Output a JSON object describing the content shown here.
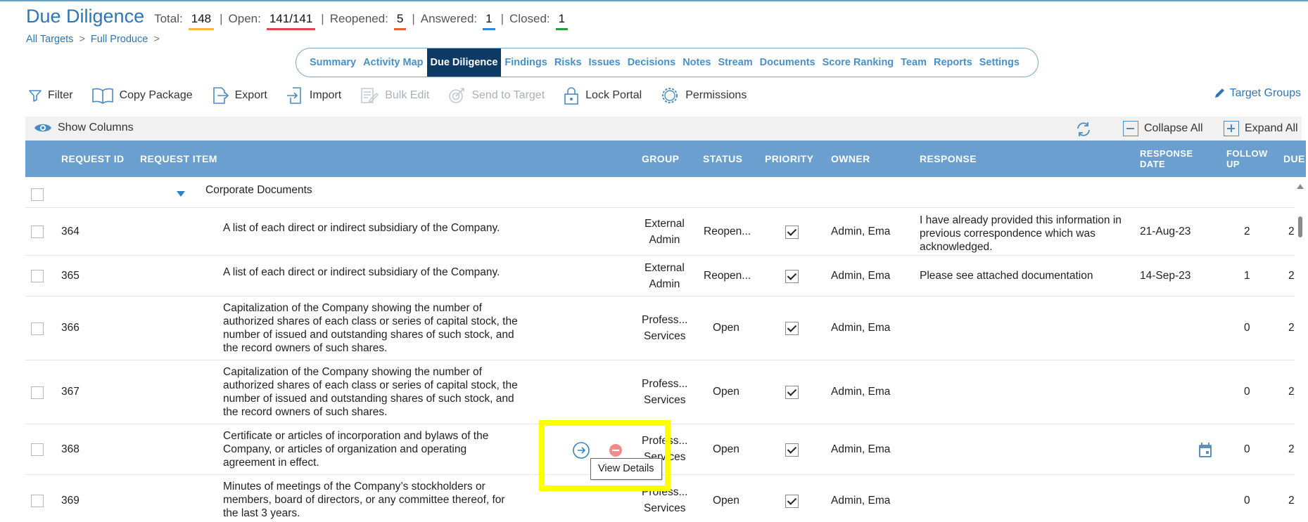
{
  "header": {
    "title": "Due Diligence",
    "stats": [
      {
        "label": "Total:",
        "value": "148",
        "color": "#f4b942"
      },
      {
        "label": "Open:",
        "value": "141/141",
        "color": "#e8404f"
      },
      {
        "label": "Reopened:",
        "value": "5",
        "color": "#e8603c"
      },
      {
        "label": "Answered:",
        "value": "1",
        "color": "#2f86d6"
      },
      {
        "label": "Closed:",
        "value": "1",
        "color": "#2a9a3c"
      }
    ],
    "separator": "|"
  },
  "breadcrumb": {
    "items": [
      "All Targets",
      "Full Produce"
    ],
    "chevron": ">"
  },
  "tabs": [
    {
      "label": "Summary",
      "active": false
    },
    {
      "label": "Activity Map",
      "active": false
    },
    {
      "label": "Due Diligence",
      "active": true
    },
    {
      "label": "Findings",
      "active": false
    },
    {
      "label": "Risks",
      "active": false
    },
    {
      "label": "Issues",
      "active": false
    },
    {
      "label": "Decisions",
      "active": false
    },
    {
      "label": "Notes",
      "active": false
    },
    {
      "label": "Stream",
      "active": false
    },
    {
      "label": "Documents",
      "active": false
    },
    {
      "label": "Score Ranking",
      "active": false
    },
    {
      "label": "Team",
      "active": false
    },
    {
      "label": "Reports",
      "active": false
    },
    {
      "label": "Settings",
      "active": false
    }
  ],
  "toolbar": {
    "filter": "Filter",
    "copy_package": "Copy Package",
    "export": "Export",
    "import": "Import",
    "bulk_edit": "Bulk Edit",
    "send_to_target": "Send to Target",
    "lock_portal": "Lock Portal",
    "permissions": "Permissions",
    "target_groups": "Target Groups"
  },
  "column_bar": {
    "show_columns": "Show Columns",
    "collapse_all": "Collapse All",
    "expand_all": "Expand All"
  },
  "columns": {
    "request_id": "REQUEST ID",
    "request_item": "REQUEST ITEM",
    "group": "GROUP",
    "status": "STATUS",
    "priority": "PRIORITY",
    "owner": "OWNER",
    "response": "RESPONSE",
    "response_date_1": "RESPONSE",
    "response_date_2": "DATE",
    "follow_up_1": "FOLLOW",
    "follow_up_2": "UP",
    "due": "DUE"
  },
  "group_row": {
    "label": "Corporate Documents"
  },
  "rows": [
    {
      "id": "364",
      "item": "A list of each direct or indirect subsidiary of the Company.",
      "group1": "External",
      "group2": "Admin",
      "status": "Reopen...",
      "owner": "Admin, Ema",
      "response": "I have already provided this information in previous correspondence which was acknowledged.",
      "response_date": "21-Aug-23",
      "follow_up": "2",
      "due": "2"
    },
    {
      "id": "365",
      "item": "A list of each direct or indirect subsidiary of the Company.",
      "group1": "External",
      "group2": "Admin",
      "status": "Reopen...",
      "owner": "Admin, Ema",
      "response": "Please see attached documentation",
      "response_date": "14-Sep-23",
      "follow_up": "1",
      "due": "2"
    },
    {
      "id": "366",
      "item": "Capitalization of the Company showing the number of authorized shares of each class or series of capital stock, the number of issued and outstanding shares of such stock, and the record owners of such shares.",
      "group1": "Profess...",
      "group2": "Services",
      "status": "Open",
      "owner": "Admin, Ema",
      "response": "",
      "response_date": "",
      "follow_up": "0",
      "due": "2"
    },
    {
      "id": "367",
      "item": "Capitalization of the Company showing the number of authorized shares of each class or series of capital stock, the number of issued and outstanding shares of such stock, and the record owners of such shares.",
      "group1": "Profess...",
      "group2": "Services",
      "status": "Open",
      "owner": "Admin, Ema",
      "response": "",
      "response_date": "",
      "follow_up": "0",
      "due": "2"
    },
    {
      "id": "368",
      "item": "Certificate or articles of incorporation and bylaws of the Company, or articles of organization and operating agreement in effect.",
      "group1": "Profess...",
      "group2": "Services",
      "status": "Open",
      "owner": "Admin, Ema",
      "response": "",
      "response_date": "",
      "follow_up": "0",
      "due": "2"
    },
    {
      "id": "369",
      "item": "Minutes of meetings of the Company’s stockholders or members, board of directors, or any committee thereof, for the last 3 years.",
      "group1": "Profess...",
      "group2": "Services",
      "status": "Open",
      "owner": "Admin, Ema",
      "response": "",
      "response_date": "",
      "follow_up": "0",
      "due": "2"
    }
  ],
  "tooltip": {
    "text": "View Details"
  },
  "colors": {
    "header_blue": "#2e75b6",
    "tab_active_bg": "#0d3b66",
    "table_header_bg": "#6a9fd0",
    "highlight": "#ffff00"
  }
}
